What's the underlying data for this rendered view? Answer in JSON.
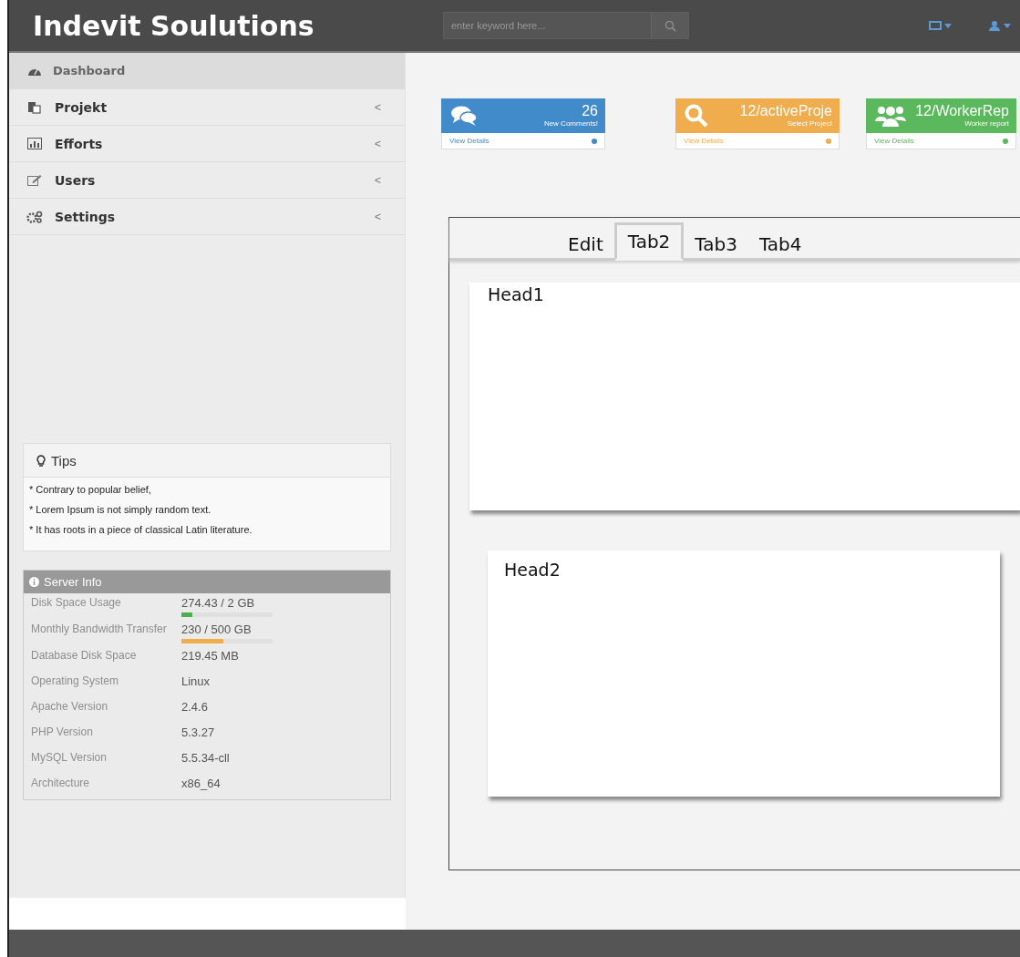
{
  "header": {
    "brand": "Indevit Soulutions",
    "search": {
      "placeholder": "enter keyword here..."
    }
  },
  "sidebar": {
    "items": [
      {
        "label": "Dashboard",
        "selected": true
      },
      {
        "label": "Projekt",
        "selected": false,
        "caret": "<"
      },
      {
        "label": "Efforts",
        "selected": false,
        "caret": "<"
      },
      {
        "label": "Users",
        "selected": false,
        "caret": "<"
      },
      {
        "label": "Settings",
        "selected": false,
        "caret": "<"
      }
    ]
  },
  "tips": {
    "title": "Tips",
    "items": [
      "* Contrary to popular belief,",
      "* Lorem Ipsum is not simply random text.",
      "* It has roots in a piece of classical Latin literature."
    ]
  },
  "server_info": {
    "title": "Server Info",
    "rows": [
      {
        "label": "Disk Space Usage",
        "value": "274.43 / 2 GB",
        "kind": "bar",
        "level": 0.12,
        "color": "#4cae4c"
      },
      {
        "label": "Monthly Bandwidth Transfer",
        "value": "230 / 500 GB",
        "kind": "bar",
        "level": 0.46,
        "color": "#f0ad4e"
      },
      {
        "label": "Database Disk Space",
        "value": "219.45 MB",
        "kind": "text"
      },
      {
        "label": "Operating System",
        "value": "Linux",
        "kind": "text"
      },
      {
        "label": "Apache Version",
        "value": "2.4.6",
        "kind": "text"
      },
      {
        "label": "PHP Version",
        "value": "5.3.27",
        "kind": "text"
      },
      {
        "label": "MySQL Version",
        "value": "5.5.34-cll",
        "kind": "text"
      },
      {
        "label": "Architecture",
        "value": "x86_64",
        "kind": "text"
      }
    ]
  },
  "stat_cards": [
    {
      "value": "26",
      "caption": "New Comments!",
      "link": "View Details",
      "color": "#428bca"
    },
    {
      "value": "12/activeProje",
      "caption": "Select Project",
      "link": "View Details",
      "color": "#f0ad4e"
    },
    {
      "value": "12/WorkerRep",
      "caption": "Worker report",
      "link": "View Details",
      "color": "#5cb85c"
    }
  ],
  "tabs": [
    {
      "label": "Edit",
      "selected": false
    },
    {
      "label": "Tab2",
      "selected": true
    },
    {
      "label": "Tab3",
      "selected": false
    },
    {
      "label": "Tab4",
      "selected": false
    }
  ],
  "sections": [
    {
      "heading": "Head1"
    },
    {
      "heading": "Head2"
    }
  ]
}
